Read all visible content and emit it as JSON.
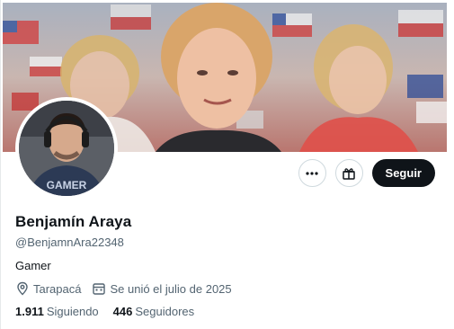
{
  "profile": {
    "name": "Benjamín Araya",
    "handle": "@BenjamnAra22348",
    "bio": "Gamer",
    "location": "Tarapacá",
    "joined": "Se unió el julio de 2025",
    "following_count": "1.911",
    "following_label": "Siguiendo",
    "followers_count": "446",
    "followers_label": "Seguidores"
  },
  "actions": {
    "more_icon": "more-horizontal-icon",
    "gift_icon": "gift-icon",
    "follow_label": "Seguir"
  },
  "avatar": {
    "shirt_text": "GAMER"
  },
  "colors": {
    "text_primary": "#0f1419",
    "text_secondary": "#536471",
    "follow_button": "#0f1419",
    "border": "#cfd9de"
  }
}
